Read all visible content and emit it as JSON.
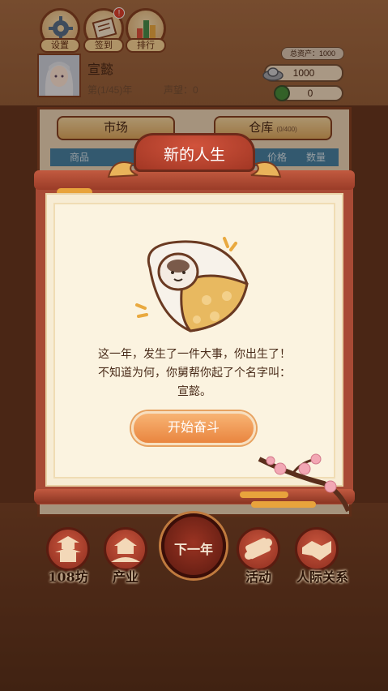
{
  "top_menu": [
    {
      "label": "设置",
      "icon": "gear-icon"
    },
    {
      "label": "签到",
      "icon": "scroll-icon",
      "badge": "!"
    },
    {
      "label": "排行",
      "icon": "bar-chart-icon"
    }
  ],
  "player": {
    "name": "宣懿",
    "year": "第(1/45)年",
    "reputation": "声望：0"
  },
  "resources": {
    "total_assets": "总资产：1000",
    "silver": "1000",
    "jade": "0"
  },
  "panel": {
    "tab_market": "市场",
    "tab_warehouse": "仓库",
    "warehouse_capacity": "(0/400)",
    "col_item": "商品",
    "col_price": "价格",
    "col_qty": "数量"
  },
  "modal": {
    "title": "新的人生",
    "story_lines": [
      "这一年，发生了一件大事，你出生了！",
      "不知道为何，你舅帮你起了个名字叫：",
      "宣懿。"
    ],
    "start_button": "开始奋斗"
  },
  "bottom_nav": {
    "items": [
      {
        "label": "108坊",
        "icon": "pagoda-icon"
      },
      {
        "label": "产业",
        "icon": "farm-icon"
      },
      {
        "label": "活动",
        "icon": "scroll-icon"
      },
      {
        "label": "人际关系",
        "icon": "handshake-icon"
      }
    ],
    "next_year": "下一年"
  },
  "colors": {
    "accent_red": "#a84a35",
    "parchment": "#f7ecd4",
    "button_orange": "#e9853f"
  }
}
